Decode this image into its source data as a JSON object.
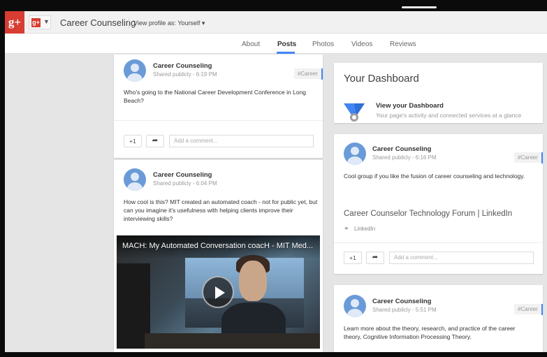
{
  "topbar": {
    "logo": "g+",
    "brand_mini": "g+",
    "page_name": "Career Counseling",
    "view_profile_as": "View profile as:  Yourself ▾"
  },
  "tabs": [
    {
      "label": "About"
    },
    {
      "label": "Posts"
    },
    {
      "label": "Photos"
    },
    {
      "label": "Videos"
    },
    {
      "label": "Reviews"
    }
  ],
  "posts_left": [
    {
      "author": "Career Counseling",
      "meta": "Shared publicly  -  6:19 PM",
      "tag": "#Career",
      "text": "Who's going to the National Career Development Conference in Long Beach?",
      "plus_one": "+1",
      "comment_placeholder": "Add a comment..."
    },
    {
      "author": "Career Counseling",
      "meta": "Shared publicly  -  6:04 PM",
      "text": "How cool is this? MIT created an automated coach - not for public yet, but can you imagine it's usefulness with helping clients improve their interviewing skills?",
      "video_title": "MACH: My Automated Conversation coacH - MIT Med..."
    }
  ],
  "dashboard": {
    "title": "Your Dashboard",
    "link": "View your Dashboard",
    "subtitle": "Your page's activity and connected services at a glance"
  },
  "posts_right": [
    {
      "author": "Career Counseling",
      "meta": "Shared publicly  -  6:16 PM",
      "tag": "#Career",
      "text": "Cool group if you like the fusion of career counseling and technology.",
      "link_title": "Career Counselor Technology Forum | LinkedIn",
      "link_source": "LinkedIn",
      "plus_one": "+1",
      "comment_placeholder": "Add a comment..."
    },
    {
      "author": "Career Counseling",
      "meta": "Shared publicly  -  5:51 PM",
      "tag": "#Career",
      "text": "Learn more about the theory, research, and practice of the career theory, Cognitive Information Processing Theory."
    }
  ],
  "colors": {
    "brand_red": "#d73d32",
    "accent_blue": "#4285f4",
    "background": "#e5e5e5"
  }
}
